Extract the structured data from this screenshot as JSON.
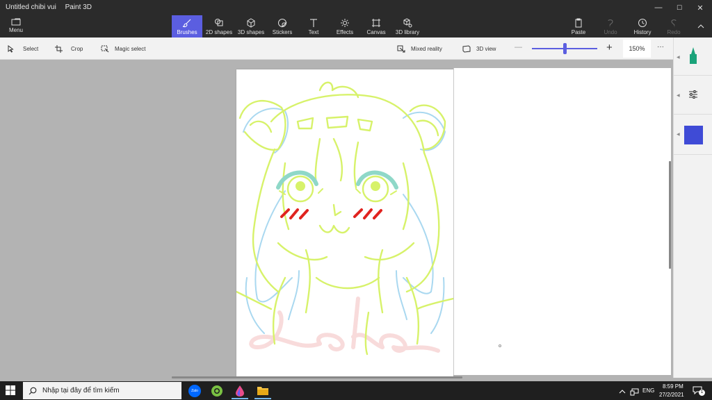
{
  "window": {
    "doc_title": "Untitled chibi vui",
    "app_name": "Paint 3D",
    "minimize": "—",
    "maximize": "☐",
    "close": "✕"
  },
  "menu": {
    "label": "Menu"
  },
  "toolbar": {
    "brushes": "Brushes",
    "shapes2d": "2D shapes",
    "shapes3d": "3D shapes",
    "stickers": "Stickers",
    "text": "Text",
    "effects": "Effects",
    "canvas": "Canvas",
    "library3d": "3D library",
    "paste": "Paste",
    "undo": "Undo",
    "history": "History",
    "redo": "Redo"
  },
  "subbar": {
    "select": "Select",
    "crop": "Crop",
    "magic_select": "Magic select",
    "mixed_reality": "Mixed reality",
    "view3d": "3D view",
    "zoom_value": "150%",
    "zoom_fraction": 0.5,
    "more": "···"
  },
  "sidepanel": {
    "marker_color": "#1aa37a",
    "current_color": "#3f4bd6"
  },
  "drawing": {
    "signature": "Laka"
  },
  "colors": {
    "accent": "#5b5ee0",
    "sketch_green": "#d7f26a",
    "sketch_blue": "#a9d8f0",
    "blush_red": "#e0231f"
  },
  "taskbar": {
    "search_placeholder": "Nhập tại đây để tìm kiếm",
    "zalo": "Zalo",
    "lang": "ENG",
    "time": "8:59 PM",
    "date": "27/2/2021",
    "notifications": "1"
  }
}
